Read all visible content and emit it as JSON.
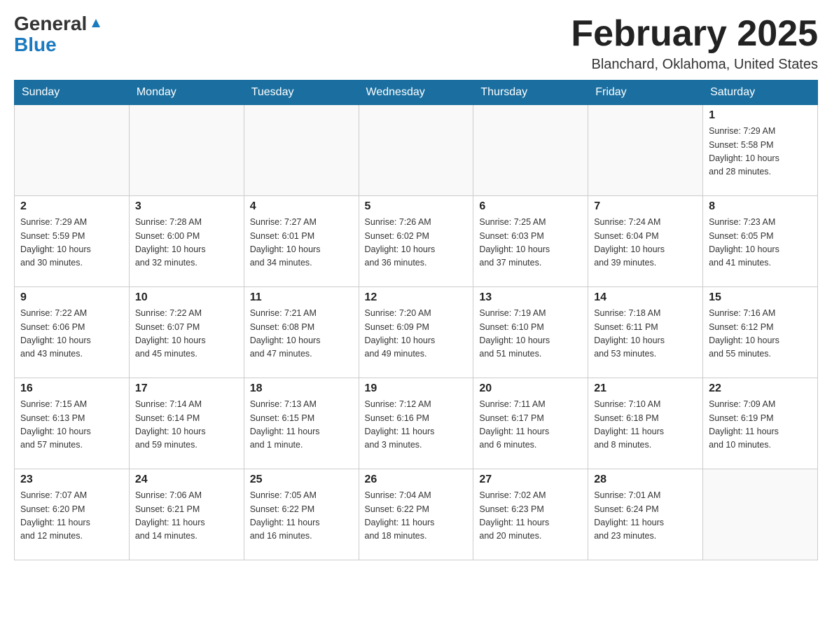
{
  "logo": {
    "general": "General",
    "blue": "Blue"
  },
  "title": "February 2025",
  "location": "Blanchard, Oklahoma, United States",
  "days_of_week": [
    "Sunday",
    "Monday",
    "Tuesday",
    "Wednesday",
    "Thursday",
    "Friday",
    "Saturday"
  ],
  "weeks": [
    [
      {
        "day": "",
        "info": ""
      },
      {
        "day": "",
        "info": ""
      },
      {
        "day": "",
        "info": ""
      },
      {
        "day": "",
        "info": ""
      },
      {
        "day": "",
        "info": ""
      },
      {
        "day": "",
        "info": ""
      },
      {
        "day": "1",
        "info": "Sunrise: 7:29 AM\nSunset: 5:58 PM\nDaylight: 10 hours\nand 28 minutes."
      }
    ],
    [
      {
        "day": "2",
        "info": "Sunrise: 7:29 AM\nSunset: 5:59 PM\nDaylight: 10 hours\nand 30 minutes."
      },
      {
        "day": "3",
        "info": "Sunrise: 7:28 AM\nSunset: 6:00 PM\nDaylight: 10 hours\nand 32 minutes."
      },
      {
        "day": "4",
        "info": "Sunrise: 7:27 AM\nSunset: 6:01 PM\nDaylight: 10 hours\nand 34 minutes."
      },
      {
        "day": "5",
        "info": "Sunrise: 7:26 AM\nSunset: 6:02 PM\nDaylight: 10 hours\nand 36 minutes."
      },
      {
        "day": "6",
        "info": "Sunrise: 7:25 AM\nSunset: 6:03 PM\nDaylight: 10 hours\nand 37 minutes."
      },
      {
        "day": "7",
        "info": "Sunrise: 7:24 AM\nSunset: 6:04 PM\nDaylight: 10 hours\nand 39 minutes."
      },
      {
        "day": "8",
        "info": "Sunrise: 7:23 AM\nSunset: 6:05 PM\nDaylight: 10 hours\nand 41 minutes."
      }
    ],
    [
      {
        "day": "9",
        "info": "Sunrise: 7:22 AM\nSunset: 6:06 PM\nDaylight: 10 hours\nand 43 minutes."
      },
      {
        "day": "10",
        "info": "Sunrise: 7:22 AM\nSunset: 6:07 PM\nDaylight: 10 hours\nand 45 minutes."
      },
      {
        "day": "11",
        "info": "Sunrise: 7:21 AM\nSunset: 6:08 PM\nDaylight: 10 hours\nand 47 minutes."
      },
      {
        "day": "12",
        "info": "Sunrise: 7:20 AM\nSunset: 6:09 PM\nDaylight: 10 hours\nand 49 minutes."
      },
      {
        "day": "13",
        "info": "Sunrise: 7:19 AM\nSunset: 6:10 PM\nDaylight: 10 hours\nand 51 minutes."
      },
      {
        "day": "14",
        "info": "Sunrise: 7:18 AM\nSunset: 6:11 PM\nDaylight: 10 hours\nand 53 minutes."
      },
      {
        "day": "15",
        "info": "Sunrise: 7:16 AM\nSunset: 6:12 PM\nDaylight: 10 hours\nand 55 minutes."
      }
    ],
    [
      {
        "day": "16",
        "info": "Sunrise: 7:15 AM\nSunset: 6:13 PM\nDaylight: 10 hours\nand 57 minutes."
      },
      {
        "day": "17",
        "info": "Sunrise: 7:14 AM\nSunset: 6:14 PM\nDaylight: 10 hours\nand 59 minutes."
      },
      {
        "day": "18",
        "info": "Sunrise: 7:13 AM\nSunset: 6:15 PM\nDaylight: 11 hours\nand 1 minute."
      },
      {
        "day": "19",
        "info": "Sunrise: 7:12 AM\nSunset: 6:16 PM\nDaylight: 11 hours\nand 3 minutes."
      },
      {
        "day": "20",
        "info": "Sunrise: 7:11 AM\nSunset: 6:17 PM\nDaylight: 11 hours\nand 6 minutes."
      },
      {
        "day": "21",
        "info": "Sunrise: 7:10 AM\nSunset: 6:18 PM\nDaylight: 11 hours\nand 8 minutes."
      },
      {
        "day": "22",
        "info": "Sunrise: 7:09 AM\nSunset: 6:19 PM\nDaylight: 11 hours\nand 10 minutes."
      }
    ],
    [
      {
        "day": "23",
        "info": "Sunrise: 7:07 AM\nSunset: 6:20 PM\nDaylight: 11 hours\nand 12 minutes."
      },
      {
        "day": "24",
        "info": "Sunrise: 7:06 AM\nSunset: 6:21 PM\nDaylight: 11 hours\nand 14 minutes."
      },
      {
        "day": "25",
        "info": "Sunrise: 7:05 AM\nSunset: 6:22 PM\nDaylight: 11 hours\nand 16 minutes."
      },
      {
        "day": "26",
        "info": "Sunrise: 7:04 AM\nSunset: 6:22 PM\nDaylight: 11 hours\nand 18 minutes."
      },
      {
        "day": "27",
        "info": "Sunrise: 7:02 AM\nSunset: 6:23 PM\nDaylight: 11 hours\nand 20 minutes."
      },
      {
        "day": "28",
        "info": "Sunrise: 7:01 AM\nSunset: 6:24 PM\nDaylight: 11 hours\nand 23 minutes."
      },
      {
        "day": "",
        "info": ""
      }
    ]
  ]
}
